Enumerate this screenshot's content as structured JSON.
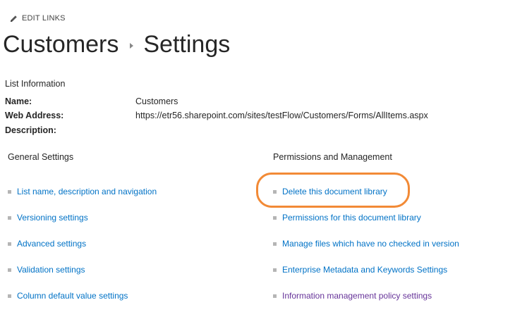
{
  "edit_links": {
    "label": "EDIT LINKS",
    "icon": "pencil-icon"
  },
  "breadcrumb": {
    "parent": "Customers",
    "current": "Settings"
  },
  "list_information": {
    "heading": "List Information",
    "name_label": "Name:",
    "name_value": "Customers",
    "web_address_label": "Web Address:",
    "web_address_value": "https://etr56.sharepoint.com/sites/testFlow/Customers/Forms/AllItems.aspx",
    "description_label": "Description:"
  },
  "general_settings": {
    "heading": "General Settings",
    "items": [
      "List name, description and navigation",
      "Versioning settings",
      "Advanced settings",
      "Validation settings",
      "Column default value settings"
    ]
  },
  "permissions_management": {
    "heading": "Permissions and Management",
    "items": [
      "Delete this document library",
      "Permissions for this document library",
      "Manage files which have no checked in version",
      "Enterprise Metadata and Keywords Settings",
      "Information management policy settings"
    ]
  },
  "colors": {
    "link": "#0072c6",
    "visited_link": "#663399",
    "highlight": "#f28a36"
  }
}
